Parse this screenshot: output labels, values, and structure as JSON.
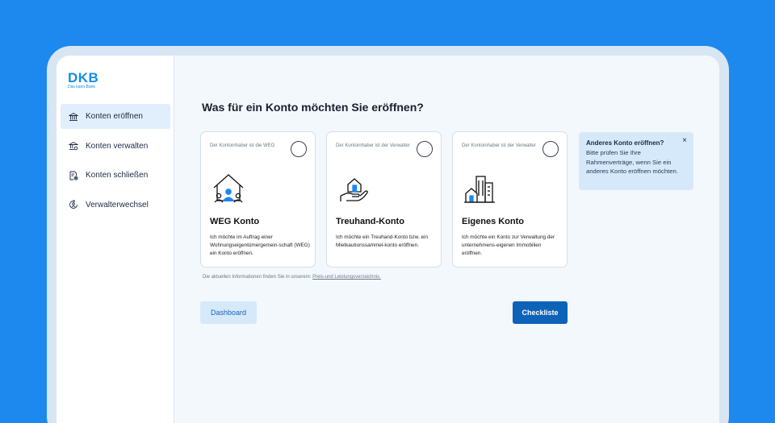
{
  "brand": {
    "name": "DKB",
    "tagline": "Das kann Bank",
    "color": "#148dea"
  },
  "sidebar": {
    "items": [
      {
        "label": "Konten eröffnen",
        "icon": "bank-icon",
        "active": true
      },
      {
        "label": "Konten verwalten",
        "icon": "bank-settings-icon",
        "active": false
      },
      {
        "label": "Konten schließen",
        "icon": "document-close-icon",
        "active": false
      },
      {
        "label": "Verwalterwechsel",
        "icon": "swap-person-icon",
        "active": false
      }
    ]
  },
  "main": {
    "title": "Was für ein Konto möchten Sie eröffnen?",
    "cards": [
      {
        "hint": "Der Kontoinhaber ist die WEG",
        "icon": "house-community-icon",
        "title": "WEG Konto",
        "description": "Ich möchte im Auftrag einer Wohnungseigentümergemein-schaft (WEG) ein Konto eröffnen."
      },
      {
        "hint": "Der Kontoinhaber ist der Verwalter",
        "icon": "hand-house-icon",
        "title": "Treuhand-Konto",
        "description": "Ich möchte ein Treuhand-Konto bzw. ein Mietkautionssammel-konto eröffnen."
      },
      {
        "hint": "Der Kontoinhaber ist der Verwalter",
        "icon": "buildings-icon",
        "title": "Eigenes Konto",
        "description": "Ich möchte ein Konto zur Verwaltung der unternehmens-eigenen Immobilien eröffnen."
      }
    ],
    "info": {
      "title": "Anderes Konto eröffnen?",
      "text": "Bitte prüfen Sie Ihre Rahmenverträge, wenn Sie ein anderes Konto eröffnen möchten.",
      "close": "×"
    },
    "footnote": {
      "text": "Die aktuellen Informationen finden Sie in unserem: ",
      "link": "Preis-und Leistungsverzeichnis."
    },
    "buttons": {
      "dashboard": "Dashboard",
      "checkliste": "Checkliste"
    }
  },
  "colors": {
    "background": "#1d88ee",
    "primary": "#0d63b8",
    "accent_light": "#d6e9fa"
  }
}
